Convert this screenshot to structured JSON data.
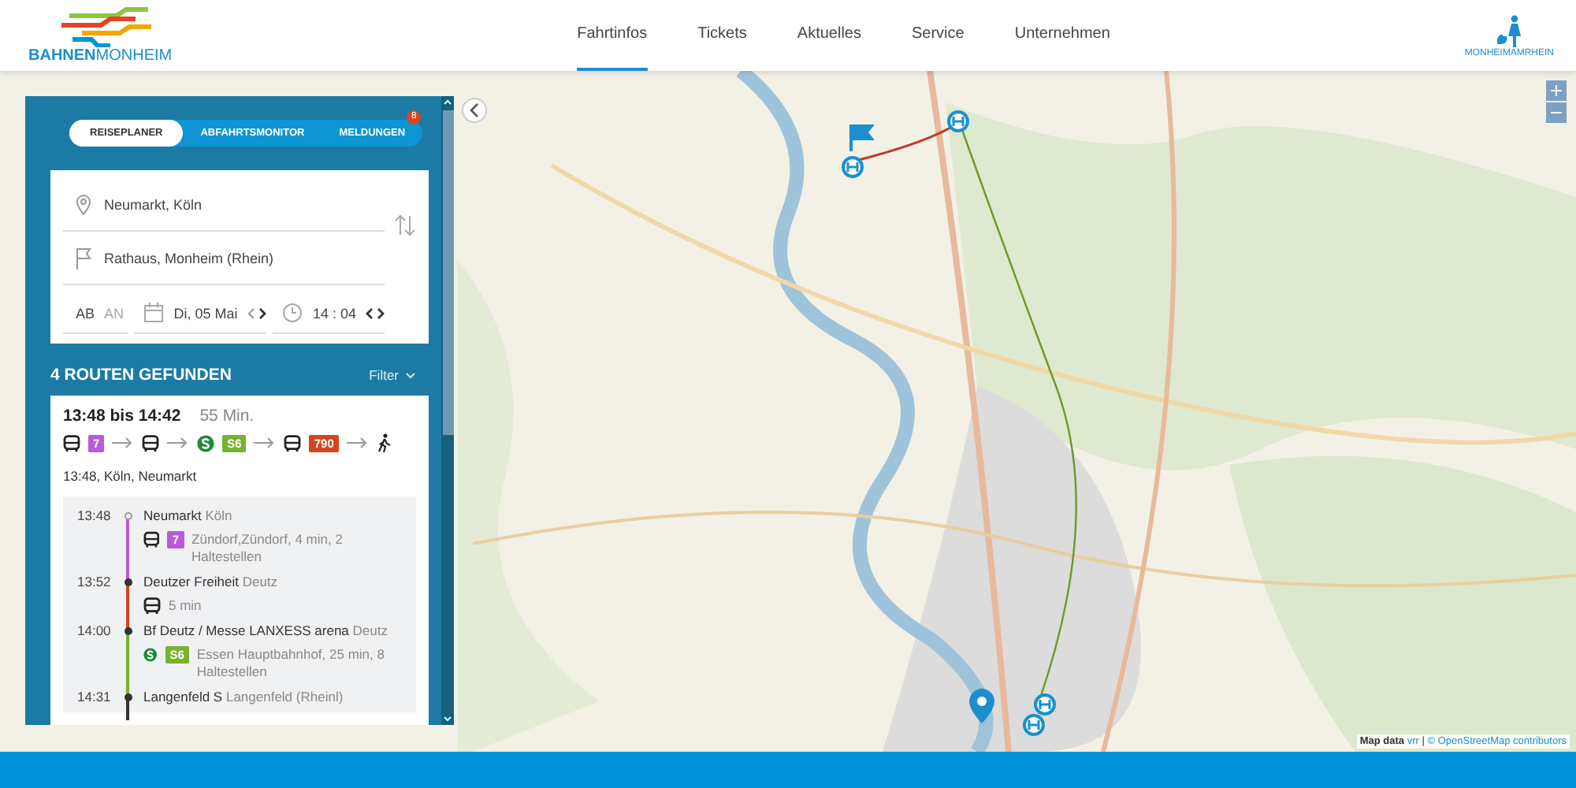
{
  "header": {
    "logo": {
      "bold": "BAHNEN",
      "light": "MONHEIM"
    },
    "nav": [
      {
        "label": "Fahrtinfos",
        "selected": true
      },
      {
        "label": "Tickets",
        "selected": false
      },
      {
        "label": "Aktuelles",
        "selected": false
      },
      {
        "label": "Service",
        "selected": false
      },
      {
        "label": "Unternehmen",
        "selected": false
      }
    ],
    "city_logo": "MONHEIMAMRHEIN"
  },
  "panel": {
    "tabs": [
      {
        "label": "REISEPLANER",
        "selected": true
      },
      {
        "label": "ABFAHRTSMONITOR",
        "selected": false
      },
      {
        "label": "MELDUNGEN",
        "selected": false,
        "badge": "8"
      }
    ],
    "form": {
      "from": "Neumarkt, Köln",
      "to": "Rathaus, Monheim (Rhein)",
      "modes": [
        {
          "label": "AB",
          "selected": true
        },
        {
          "label": "AN",
          "selected": false
        }
      ],
      "date": "Di, 05 Mai",
      "time": "14 : 04"
    },
    "results_title": "4 ROUTEN GEFUNDEN",
    "filter": "Filter",
    "route": {
      "times": "13:48 bis 14:42",
      "duration": "55 Min.",
      "legs": [
        {
          "kind": "bus",
          "line": "7",
          "color": "#b95bd6"
        },
        {
          "kind": "bus"
        },
        {
          "kind": "sbahn",
          "line": "S6",
          "color": "#78b22f"
        },
        {
          "kind": "bus",
          "line": "790",
          "color": "#d2451e"
        },
        {
          "kind": "walk"
        }
      ],
      "departure": "13:48, Köln, Neumarkt",
      "stops": [
        {
          "time": "13:48",
          "name": "Neumarkt",
          "area": "Köln",
          "start": true,
          "color": "#b95bd6",
          "leg": {
            "kind": "bus",
            "line": "7",
            "color": "#b95bd6",
            "text": "Zündorf,Zündorf, 4 min, 2 Haltestellen"
          }
        },
        {
          "time": "13:52",
          "name": "Deutzer Freiheit",
          "area": "Deutz",
          "start": false,
          "color": "#d2451e",
          "leg": {
            "kind": "bus",
            "text": "5 min"
          }
        },
        {
          "time": "14:00",
          "name": "Bf Deutz / Messe LANXESS arena",
          "area": "Deutz",
          "start": false,
          "color": "#78b22f",
          "leg": {
            "kind": "sbahn",
            "line": "S6",
            "color": "#78b22f",
            "text": "Essen Hauptbahnhof, 25 min, 8 Haltestellen"
          }
        },
        {
          "time": "14:31",
          "name": "Langenfeld S",
          "area": "Langenfeld (Rheinl)",
          "start": false,
          "color": "#333333"
        }
      ]
    }
  },
  "map": {
    "zoom": [
      "+",
      "−"
    ],
    "attribution": {
      "label": "Map data",
      "source": "vrr",
      "separator": "|",
      "credit": "© OpenStreetMap contributors"
    }
  }
}
